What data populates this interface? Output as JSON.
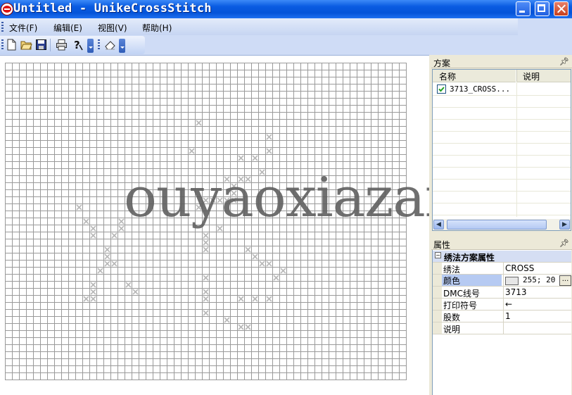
{
  "window": {
    "title": "Untitled - UnikeCrossStitch"
  },
  "menu": [
    {
      "label": "文件(F)"
    },
    {
      "label": "编辑(E)"
    },
    {
      "label": "视图(V)"
    },
    {
      "label": "帮助(H)"
    }
  ],
  "toolbar": {
    "buttons": [
      "new-file-icon",
      "open-folder-icon",
      "save-icon",
      "print-icon",
      "help-icon",
      "eraser-icon"
    ]
  },
  "canvas": {
    "grid_columns": 57,
    "grid_rows": 45,
    "stitch_color": "#b8b8b8",
    "stitches": [
      [
        27,
        8
      ],
      [
        37,
        10
      ],
      [
        26,
        12
      ],
      [
        37,
        12
      ],
      [
        33,
        13
      ],
      [
        35,
        13
      ],
      [
        36,
        15
      ],
      [
        31,
        16
      ],
      [
        33,
        16
      ],
      [
        34,
        16
      ],
      [
        32,
        17
      ],
      [
        32,
        18
      ],
      [
        28,
        19
      ],
      [
        29,
        19
      ],
      [
        30,
        19
      ],
      [
        31,
        19
      ],
      [
        32,
        19
      ],
      [
        10,
        20
      ],
      [
        27,
        20
      ],
      [
        11,
        22
      ],
      [
        16,
        22
      ],
      [
        12,
        23
      ],
      [
        16,
        23
      ],
      [
        30,
        23
      ],
      [
        12,
        24
      ],
      [
        15,
        24
      ],
      [
        28,
        24
      ],
      [
        28,
        25
      ],
      [
        14,
        26
      ],
      [
        28,
        26
      ],
      [
        14,
        27
      ],
      [
        34,
        26
      ],
      [
        15,
        28
      ],
      [
        35,
        27
      ],
      [
        14,
        28
      ],
      [
        36,
        28
      ],
      [
        13,
        29
      ],
      [
        37,
        28
      ],
      [
        39,
        29
      ],
      [
        12,
        31
      ],
      [
        17,
        31
      ],
      [
        28,
        30
      ],
      [
        38,
        30
      ],
      [
        12,
        32
      ],
      [
        18,
        32
      ],
      [
        28,
        32
      ],
      [
        12,
        33
      ],
      [
        11,
        33
      ],
      [
        28,
        33
      ],
      [
        33,
        33
      ],
      [
        35,
        33
      ],
      [
        37,
        33
      ],
      [
        28,
        35
      ],
      [
        31,
        36
      ],
      [
        33,
        37
      ],
      [
        34,
        37
      ]
    ],
    "watermark": "ouyaoxiazai"
  },
  "scheme_panel": {
    "title": "方案",
    "columns": [
      "名称",
      "说明"
    ],
    "rows": [
      {
        "checked": true,
        "name": "3713_CROSS...",
        "note": ""
      }
    ]
  },
  "property_panel": {
    "title": "属性",
    "category": "绣法方案属性",
    "rows": [
      {
        "name": "绣法",
        "value": "CROSS",
        "selected": false
      },
      {
        "name": "颜色",
        "value": "255; 20",
        "selected": true,
        "swatch": "#e6e6e6"
      },
      {
        "name": "DMC线号",
        "value": "3713",
        "selected": false
      },
      {
        "name": "打印符号",
        "value": "←",
        "selected": false
      },
      {
        "name": "股数",
        "value": "1",
        "selected": false
      },
      {
        "name": "说明",
        "value": "",
        "selected": false
      }
    ]
  },
  "colors": {
    "titlebar": "#0553d8",
    "grid_line": "#9a9a9a",
    "selected_property": "#b6caf2"
  }
}
